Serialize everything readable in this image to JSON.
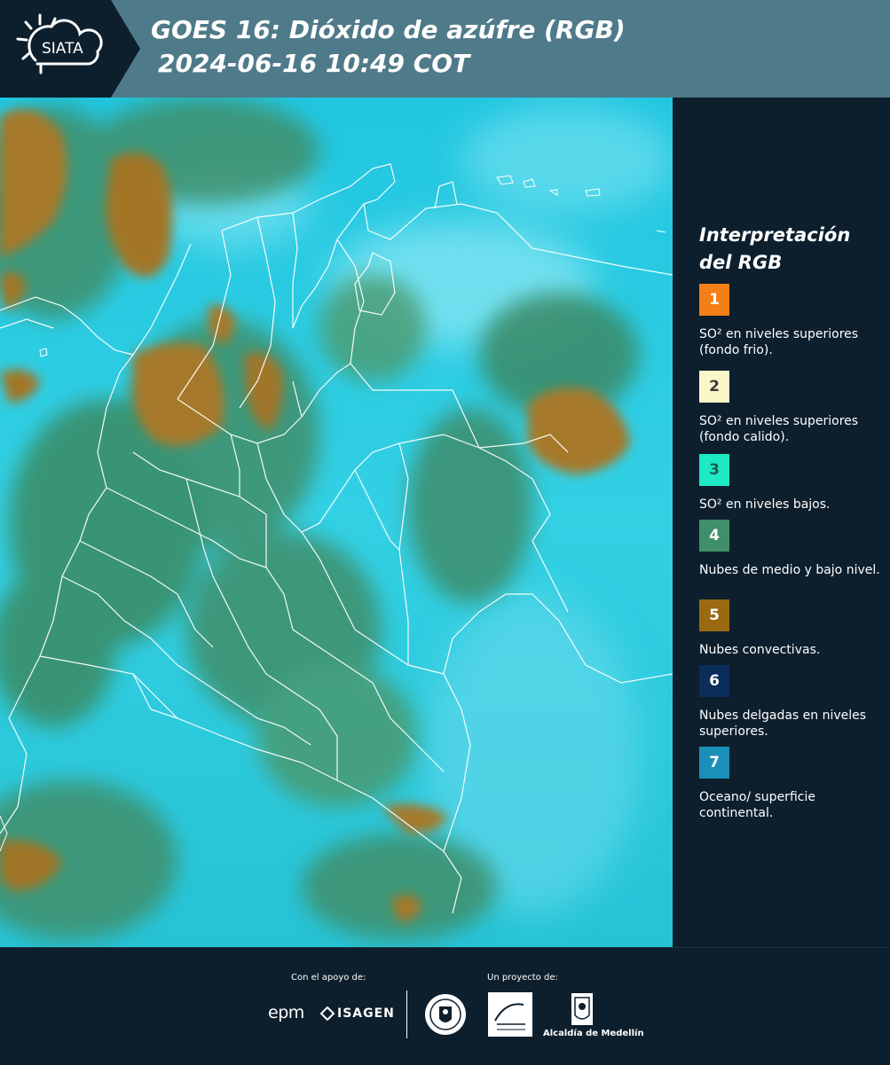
{
  "header": {
    "logo_text": "SIATA",
    "title_line1": "GOES 16: Dióxido de azúfre (RGB)",
    "title_line2": "2024-06-16 10:49 COT"
  },
  "legend": {
    "title": "Interpretación del RGB",
    "items": [
      {
        "number": "1",
        "label": "SO² en niveles superiores (fondo frio).",
        "color": "#f57f17",
        "text_color": "#ffffff"
      },
      {
        "number": "2",
        "label": "SO² en niveles superiores (fondo calido).",
        "color": "#fbf6c8",
        "text_color": "#3a3a3a"
      },
      {
        "number": "3",
        "label": "SO² en niveles bajos.",
        "color": "#1de9c3",
        "text_color": "#1e5a55"
      },
      {
        "number": "4",
        "label": "Nubes de medio y bajo nivel.",
        "color": "#3f8f6a",
        "text_color": "#ffffff"
      },
      {
        "number": "5",
        "label": "Nubes convectivas.",
        "color": "#9a6a12",
        "text_color": "#ffffff"
      },
      {
        "number": "6",
        "label": "Nubes delgadas en niveles superiores.",
        "color": "#0b2d5a",
        "text_color": "#ffffff"
      },
      {
        "number": "7",
        "label": "Oceano/ superficie continental.",
        "color": "#1a8fb8",
        "text_color": "#ffffff"
      }
    ]
  },
  "footer": {
    "support_caption": "Con el apoyo de:",
    "project_caption": "Un proyecto de:",
    "supporters": [
      "epm",
      "ISAGEN"
    ],
    "project_partners": [
      "Área METROPOLITANA Valle de Aburrá",
      "Alcaldía de Medellín"
    ]
  },
  "colors": {
    "header_bg": "#4f7a89",
    "logo_bg": "#0d1f2d",
    "panel_bg": "#0d1f2d",
    "ocean": "#27c8dc",
    "vegetation": "#3f8f6a",
    "convective": "#a6792a"
  }
}
